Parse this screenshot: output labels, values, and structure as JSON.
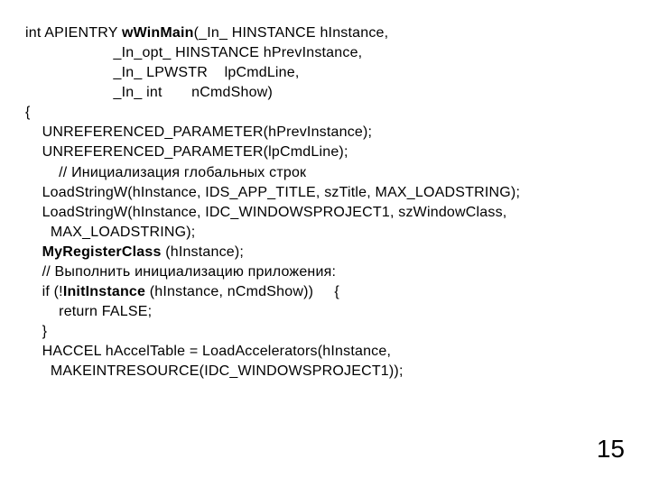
{
  "code": {
    "l1a": "int APIENTRY ",
    "l1b": "wWinMain",
    "l1c": "(_In_ HINSTANCE hInstance,",
    "l2": "                     _In_opt_ HINSTANCE hPrevInstance,",
    "l3": "                     _In_ LPWSTR    lpCmdLine,",
    "l4": "                     _In_ int       nCmdShow)",
    "l5": "{",
    "l6": "    UNREFERENCED_PARAMETER(hPrevInstance);",
    "l7": "    UNREFERENCED_PARAMETER(lpCmdLine);",
    "l8": "        // Инициализация глобальных строк",
    "l9": "    LoadStringW(hInstance, IDS_APP_TITLE, szTitle, MAX_LOADSTRING);",
    "l10": "    LoadStringW(hInstance, IDC_WINDOWSPROJECT1, szWindowClass,\n      MAX_LOADSTRING);",
    "l11a": "    ",
    "l11b": "MyRegisterClass",
    "l11c": " (hInstance);",
    "l12": "",
    "l13": "    // Выполнить инициализацию приложения:",
    "l14a": "    if (!",
    "l14b": "InitInstance",
    "l14c": " (hInstance, nCmdShow))     {",
    "l15": "        return FALSE;",
    "l16": "    }",
    "l17": "    HACCEL hAccelTable = LoadAccelerators(hInstance,\n      MAKEINTRESOURCE(IDC_WINDOWSPROJECT1));"
  },
  "pagenum": "15"
}
